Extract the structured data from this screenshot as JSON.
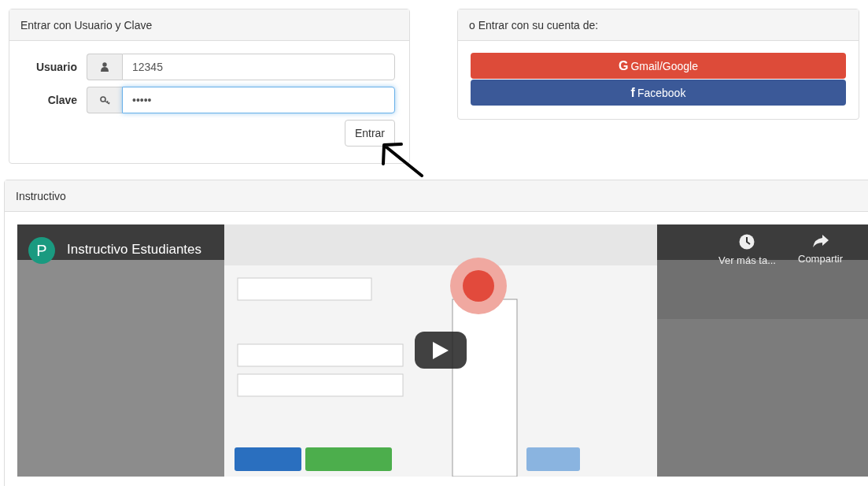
{
  "login_panel": {
    "title": "Entrar con Usuario y Clave",
    "fields": [
      {
        "label": "Usuario",
        "kind": "user",
        "value": "12345",
        "focused": false
      },
      {
        "label": "Clave",
        "kind": "key",
        "value": "•••••",
        "focused": true
      }
    ],
    "submit": "Entrar"
  },
  "social_panel": {
    "title": "o Entrar con su cuenta de:",
    "buttons": [
      {
        "kind": "google",
        "icon_text": "G",
        "label": "Gmail/Google"
      },
      {
        "kind": "facebook",
        "icon_text": "f",
        "label": "Facebook"
      }
    ]
  },
  "instructions_panel": {
    "title": "Instructivo",
    "video": {
      "kind": "picture",
      "channel_initial": "P",
      "title": "Instructivo Estudiantes",
      "actions": [
        {
          "kind": "watch_later",
          "label": "Ver más ta..."
        },
        {
          "kind": "share",
          "label": "Compartir"
        }
      ]
    }
  }
}
